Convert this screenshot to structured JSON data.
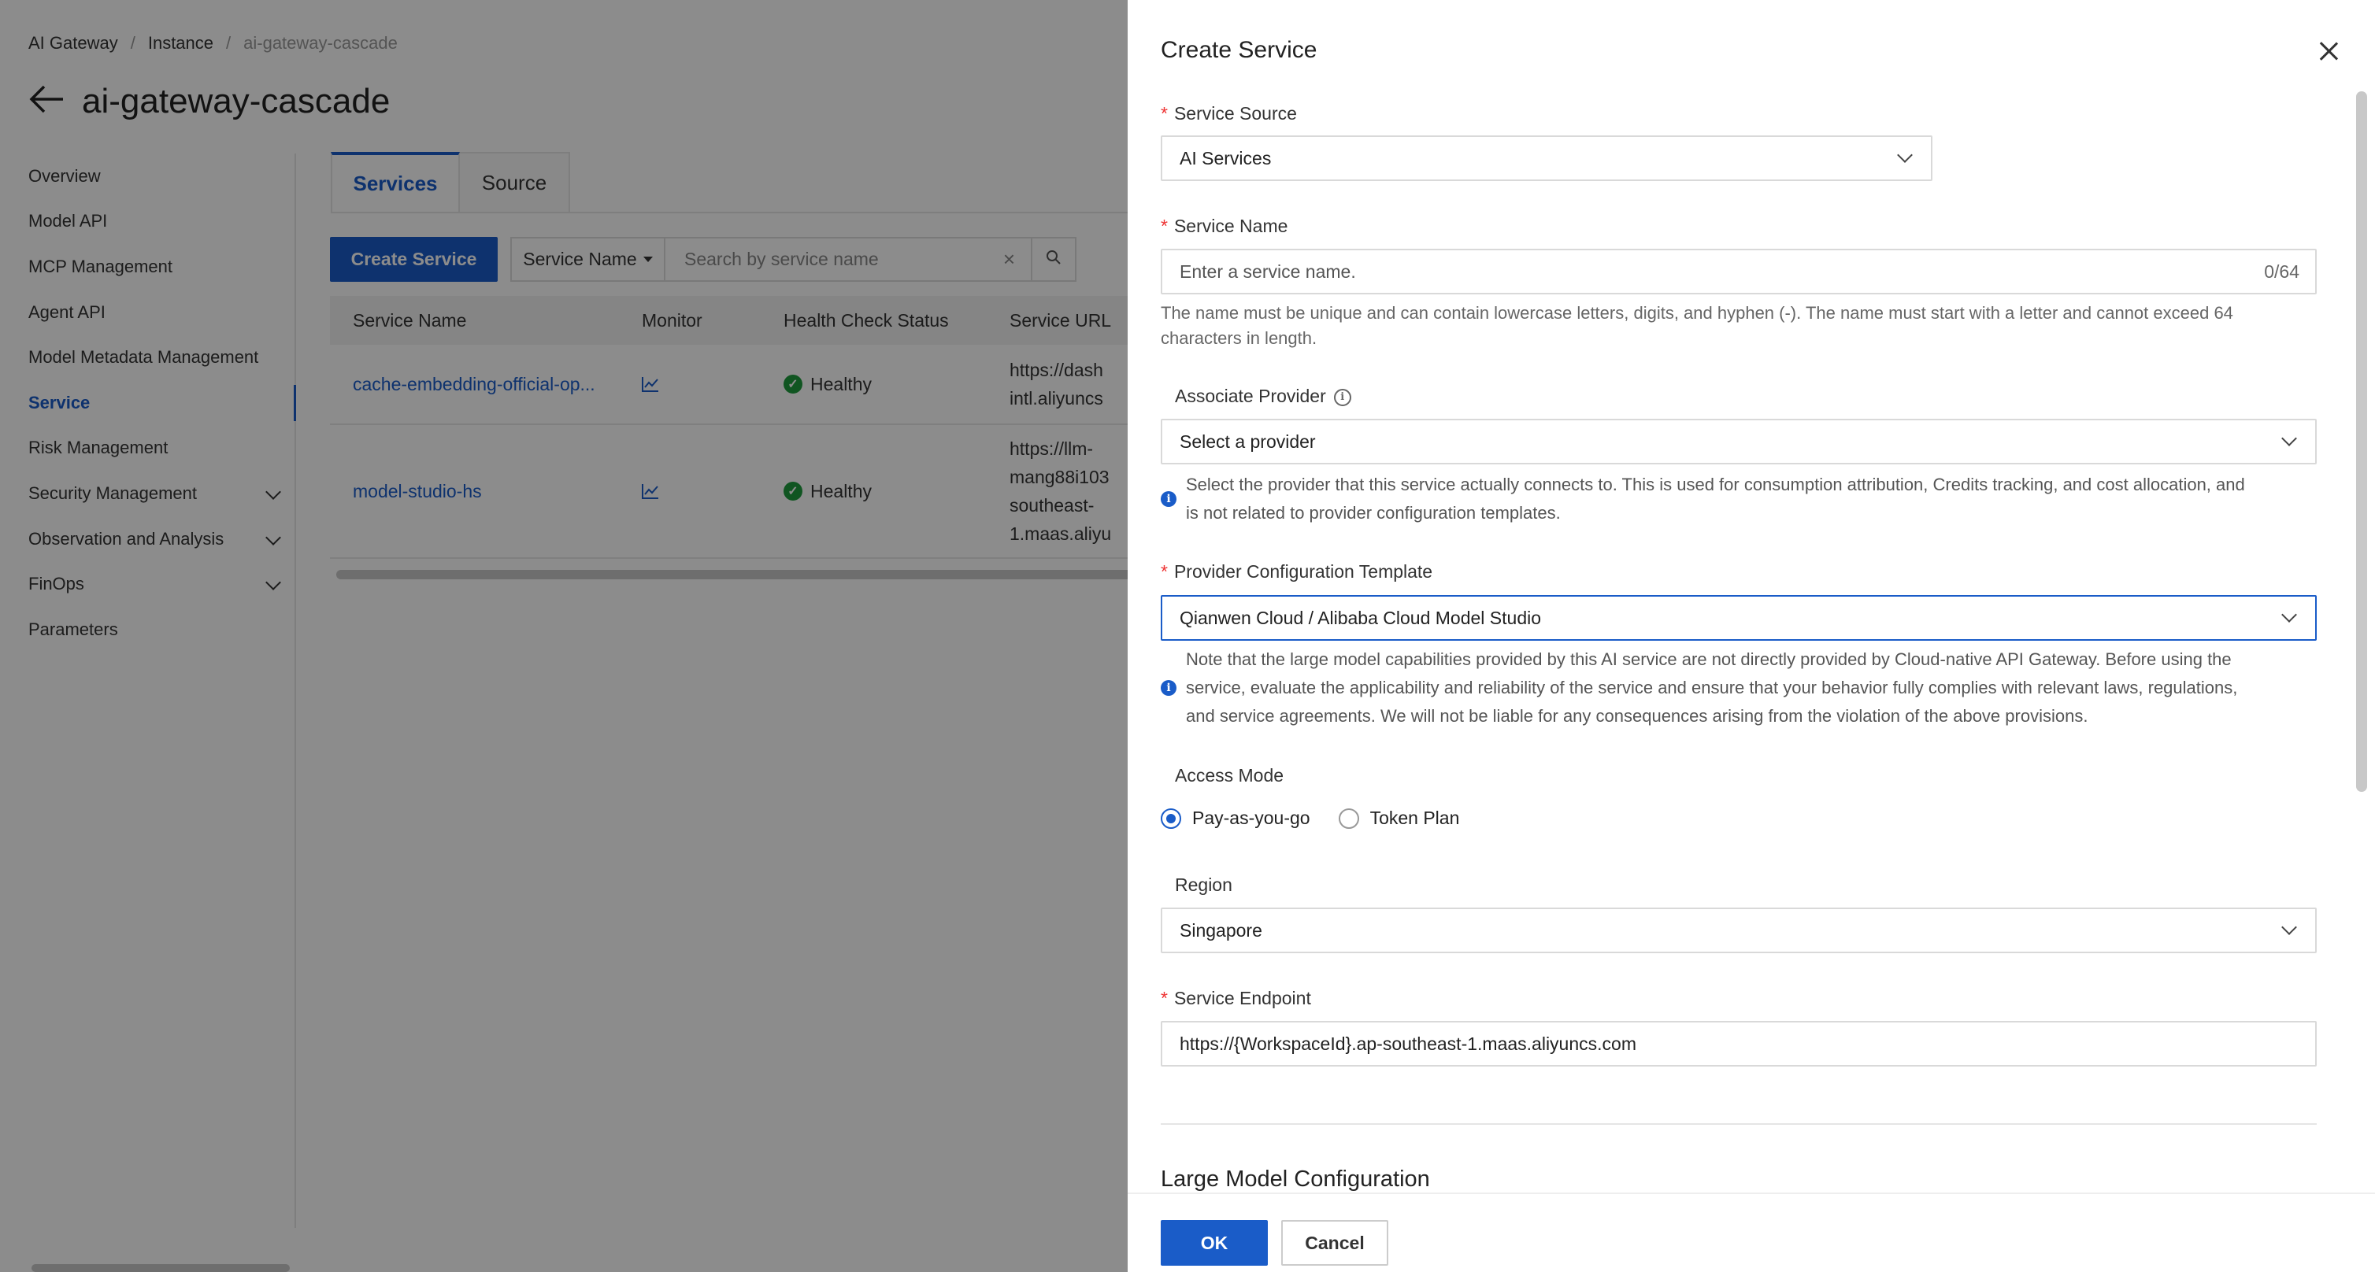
{
  "breadcrumb": [
    "AI Gateway",
    "Instance",
    "ai-gateway-cascade"
  ],
  "page_title": "ai-gateway-cascade",
  "sidebar": {
    "items": [
      {
        "label": "Overview"
      },
      {
        "label": "Model API"
      },
      {
        "label": "MCP Management"
      },
      {
        "label": "Agent API"
      },
      {
        "label": "Model Metadata Management"
      },
      {
        "label": "Service",
        "active": true
      },
      {
        "label": "Risk Management"
      },
      {
        "label": "Security Management",
        "expandable": true
      },
      {
        "label": "Observation and Analysis",
        "expandable": true
      },
      {
        "label": "FinOps",
        "expandable": true
      },
      {
        "label": "Parameters"
      }
    ]
  },
  "tabs": [
    "Services",
    "Source"
  ],
  "toolbar": {
    "create_label": "Create Service",
    "filter_field": "Service Name",
    "search_placeholder": "Search by service name"
  },
  "table": {
    "headers": [
      "Service Name",
      "Monitor",
      "Health Check Status",
      "Service URL"
    ],
    "rows": [
      {
        "name": "cache-embedding-official-op...",
        "health": "Healthy",
        "url_lines": [
          "https://dash",
          "intl.aliyuncs"
        ]
      },
      {
        "name": "model-studio-hs",
        "health": "Healthy",
        "url_lines": [
          "https://llm-",
          "mang88i103",
          "southeast-",
          "1.maas.aliyu"
        ]
      }
    ]
  },
  "drawer": {
    "title": "Create Service",
    "service_source": {
      "label": "Service Source",
      "value": "AI Services"
    },
    "service_name": {
      "label": "Service Name",
      "placeholder": "Enter a service name.",
      "counter": "0/64",
      "help_line1": "The name must be unique and can contain lowercase letters, digits, and hyphen (-). The name must start with a letter and cannot exceed 64",
      "help_line2": "characters in length."
    },
    "associate_provider": {
      "label": "Associate Provider",
      "placeholder": "Select a provider",
      "note_line1": "Select the provider that this service actually connects to. This is used for consumption attribution, Credits tracking, and cost allocation, and",
      "note_line2": "is not related to provider configuration templates."
    },
    "provider_template": {
      "label": "Provider Configuration Template",
      "value": "Qianwen Cloud / Alibaba Cloud Model Studio",
      "note_line1": "Note that the large model capabilities provided by this AI service are not directly provided by Cloud-native API Gateway. Before using the",
      "note_line2": "service, evaluate the applicability and reliability of the service and ensure that your behavior fully complies with relevant laws, regulations,",
      "note_line3": "and service agreements. We will not be liable for any consequences arising from the violation of the above provisions."
    },
    "access_mode": {
      "label": "Access Mode",
      "options": [
        {
          "label": "Pay-as-you-go",
          "selected": true
        },
        {
          "label": "Token Plan",
          "selected": false
        }
      ]
    },
    "region": {
      "label": "Region",
      "value": "Singapore"
    },
    "service_endpoint": {
      "label": "Service Endpoint",
      "value": "https://{WorkspaceId}.ap-southeast-1.maas.aliyuncs.com"
    },
    "large_model_section": "Large Model Configuration",
    "ok_label": "OK",
    "cancel_label": "Cancel"
  },
  "colors": {
    "accent": "#1a5cc8",
    "required": "#e33333",
    "healthy": "#1e9b3c"
  }
}
